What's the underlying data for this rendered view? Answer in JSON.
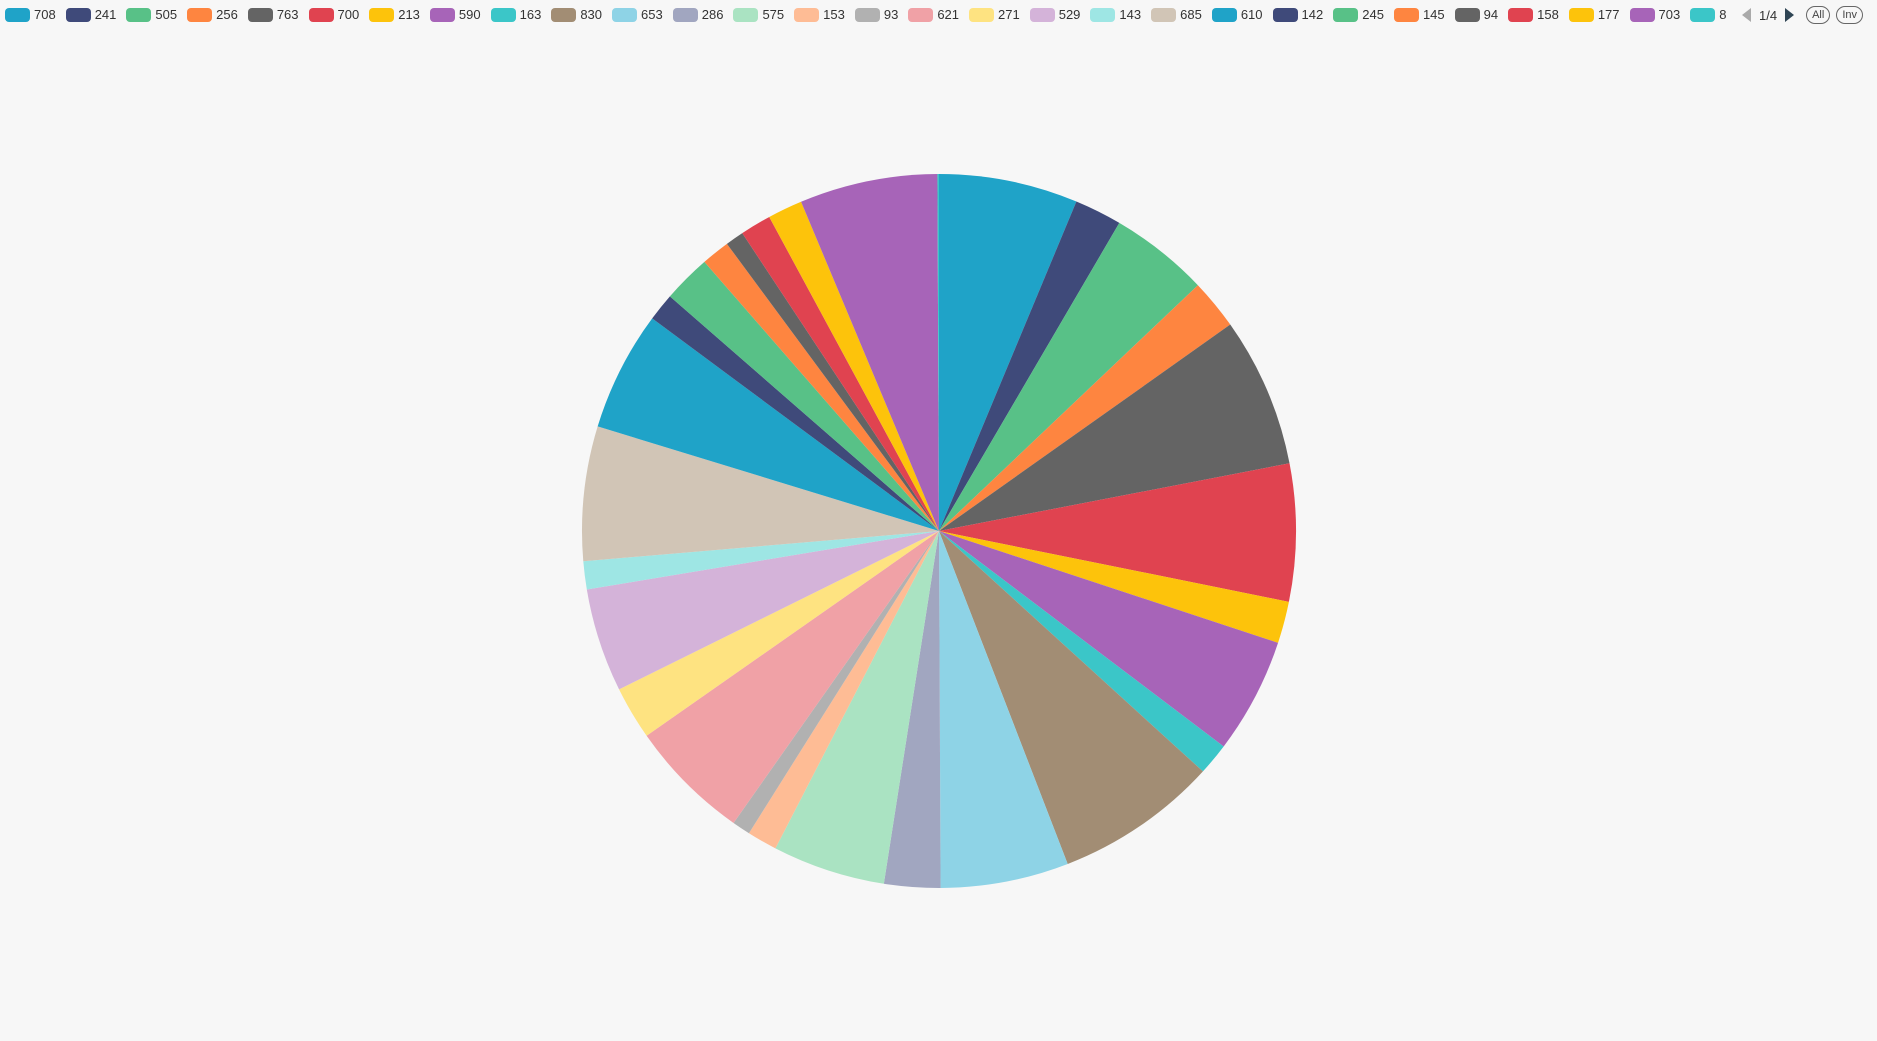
{
  "chart_data": {
    "type": "pie",
    "categories": [
      "708",
      "241",
      "505",
      "256",
      "763",
      "700",
      "213",
      "590",
      "163",
      "830",
      "653",
      "286",
      "575",
      "153",
      "93",
      "621",
      "271",
      "529",
      "143",
      "685",
      "610",
      "142",
      "245",
      "145",
      "94",
      "158",
      "177",
      "703",
      "8"
    ],
    "values": [
      708,
      241,
      505,
      256,
      763,
      700,
      213,
      590,
      163,
      830,
      653,
      286,
      575,
      153,
      93,
      621,
      271,
      529,
      143,
      685,
      610,
      142,
      245,
      145,
      94,
      158,
      177,
      703,
      8
    ],
    "legend_position": "top",
    "colors": [
      "#1fa3c8",
      "#3f4a7a",
      "#58c187",
      "#fe8540",
      "#646464",
      "#e04350",
      "#fdc30b",
      "#a764b8",
      "#3bc6c8",
      "#a28d74",
      "#8ed3e6",
      "#a1a6c0",
      "#aae3c2",
      "#febc95",
      "#b1b1b1",
      "#f0a1a6",
      "#fee381",
      "#d4b3d9",
      "#9ee6e4",
      "#d1c5b6"
    ]
  },
  "legend": {
    "page_indicator": "1/4",
    "all_label": "All",
    "inverse_label": "Inv"
  }
}
